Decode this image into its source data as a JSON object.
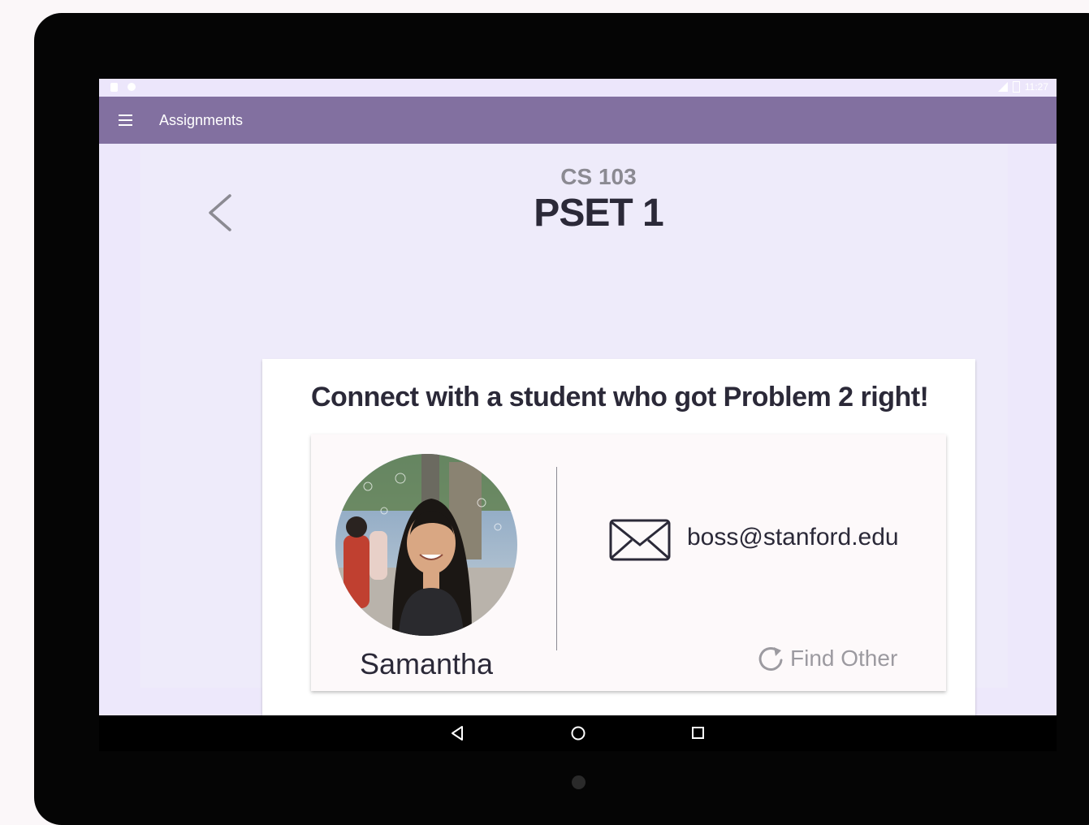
{
  "status_bar": {
    "time": "11:27"
  },
  "app_bar": {
    "title": "Assignments"
  },
  "assignment": {
    "course": "CS 103",
    "title": "PSET 1"
  },
  "card": {
    "heading": "Connect with a student who got Problem 2 right!",
    "student": {
      "name": "Samantha",
      "email": "boss@stanford.edu"
    },
    "find_other_label": "Find Other"
  },
  "icons": {
    "menu": "hamburger-icon",
    "back": "chevron-left-icon",
    "mail": "envelope-icon",
    "refresh": "refresh-icon",
    "nav_back": "triangle-back-icon",
    "nav_home": "circle-home-icon",
    "nav_recents": "square-recents-icon"
  },
  "colors": {
    "app_bar": "#8270a0",
    "screen_bg": "#ede8fb",
    "text_dark": "#2b2938",
    "text_muted": "#8b8a92"
  }
}
